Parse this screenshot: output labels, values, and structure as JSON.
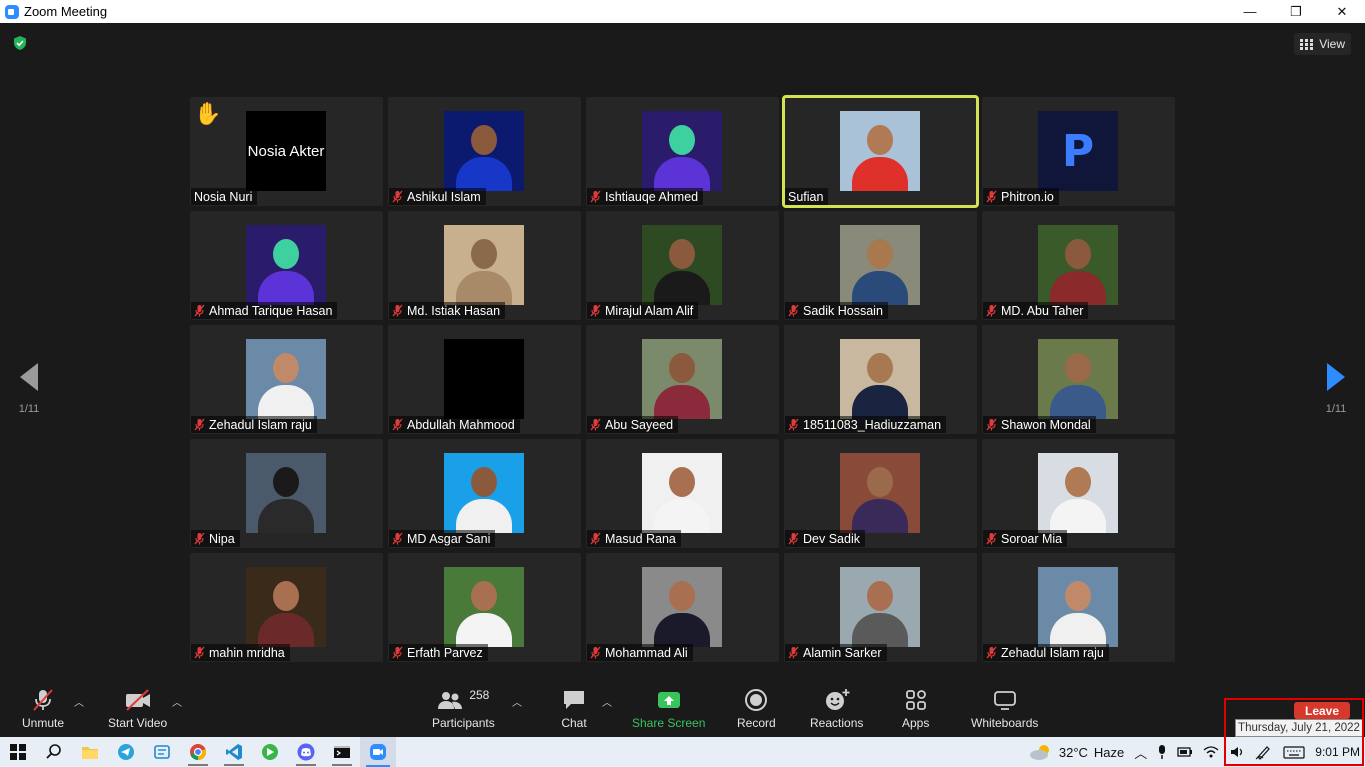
{
  "window": {
    "title": "Zoom Meeting",
    "minimize": "—",
    "maximize": "❐",
    "close": "✕"
  },
  "view_button": {
    "label": "View"
  },
  "pagination": {
    "left": "1/11",
    "right": "1/11"
  },
  "participants": [
    {
      "name": "Nosia Nuri",
      "avatar_text": "Nosia Akter",
      "avatar_bg": "#000000",
      "hand_raised": true,
      "muted": false
    },
    {
      "name": "Ashikul Islam",
      "avatar_bg": "#0b1a6e",
      "skin": "#8b5a3c",
      "shirt": "#1737c9",
      "muted": true
    },
    {
      "name": "Ishtiauqe Ahmed",
      "avatar_bg": "#2a1c6b",
      "skin": "#3fd0a0",
      "shirt": "#5b33d6",
      "muted": true
    },
    {
      "name": "Sufian",
      "avatar_bg": "#a9c2d8",
      "skin": "#b07a55",
      "shirt": "#e0302a",
      "muted": false,
      "active_speaker": true
    },
    {
      "name": "Phitron.io",
      "avatar_bg": "#10163a",
      "logo": "P",
      "muted": true
    },
    {
      "name": "Ahmad Tarique Hasan",
      "avatar_bg": "#2a1c6b",
      "skin": "#3fd0a0",
      "shirt": "#5b33d6",
      "muted": true
    },
    {
      "name": "Md. Istiak Hasan",
      "avatar_bg": "#c8b08e",
      "skin": "#8a6a4a",
      "shirt": "#a88a68",
      "muted": true
    },
    {
      "name": "Mirajul Alam Alif",
      "avatar_bg": "#2e4a22",
      "skin": "#8b5a3c",
      "shirt": "#1a1a1a",
      "muted": true
    },
    {
      "name": "Sadik Hossain",
      "avatar_bg": "#8a8a7a",
      "skin": "#a8784e",
      "shirt": "#2a4a7a",
      "muted": true
    },
    {
      "name": "MD. Abu Taher",
      "avatar_bg": "#3a5a2a",
      "skin": "#8b5a3c",
      "shirt": "#8a2a2a",
      "muted": true
    },
    {
      "name": "Zehadul Islam raju",
      "avatar_bg": "#6a8aa8",
      "skin": "#c08a6a",
      "shirt": "#f0f0f0",
      "muted": true
    },
    {
      "name": "Abdullah Mahmood",
      "avatar_bg": "#000000",
      "blank": true,
      "muted": true
    },
    {
      "name": "Abu Sayeed",
      "avatar_bg": "#7a8a6a",
      "skin": "#8b5a3c",
      "shirt": "#8a2a3a",
      "muted": true
    },
    {
      "name": "18511083_Hadiuzzaman",
      "avatar_bg": "#c8b8a0",
      "skin": "#a87850",
      "shirt": "#1a2440",
      "muted": true
    },
    {
      "name": "Shawon Mondal",
      "avatar_bg": "#6a7a4a",
      "skin": "#9a6a4a",
      "shirt": "#3a5a8a",
      "muted": true
    },
    {
      "name": "Nipa",
      "avatar_bg": "#4a5a6a",
      "skin": "#1a1a1a",
      "shirt": "#2a2a2a",
      "muted": true
    },
    {
      "name": "MD Asgar Sani",
      "avatar_bg": "#1aa0e8",
      "skin": "#8b5a3c",
      "shirt": "#f0f0f0",
      "muted": true
    },
    {
      "name": "Masud Rana",
      "avatar_bg": "#f0f0f0",
      "skin": "#a87050",
      "shirt": "#f4f4f4",
      "muted": true
    },
    {
      "name": "Dev Sadik",
      "avatar_bg": "#8a4a3a",
      "skin": "#9a6a4a",
      "shirt": "#3a2a5a",
      "muted": true
    },
    {
      "name": "Soroar Mia",
      "avatar_bg": "#d8dde4",
      "skin": "#b07a55",
      "shirt": "#f4f4f4",
      "muted": true
    },
    {
      "name": "mahin mridha",
      "avatar_bg": "#3a2a1a",
      "skin": "#a87050",
      "shirt": "#6a2a2a",
      "muted": true
    },
    {
      "name": "Erfath Parvez",
      "avatar_bg": "#4a7a3a",
      "skin": "#a87050",
      "shirt": "#f4f4f4",
      "muted": true
    },
    {
      "name": "Mohammad Ali",
      "avatar_bg": "#8a8a8a",
      "skin": "#a87050",
      "shirt": "#1a1a2a",
      "muted": true
    },
    {
      "name": "Alamin Sarker",
      "avatar_bg": "#9aa8b0",
      "skin": "#a87050",
      "shirt": "#5a5a5a",
      "muted": true
    },
    {
      "name": "Zehadul Islam raju",
      "avatar_bg": "#6a8aa8",
      "skin": "#c08a6a",
      "shirt": "#f0f0f0",
      "muted": true
    }
  ],
  "toolbar": {
    "unmute": "Unmute",
    "start_video": "Start Video",
    "participants": "Participants",
    "participant_count": "258",
    "chat": "Chat",
    "share_screen": "Share Screen",
    "record": "Record",
    "reactions": "Reactions",
    "apps": "Apps",
    "whiteboards": "Whiteboards",
    "leave": "Leave"
  },
  "tooltip": {
    "date": "Thursday, July 21, 2022"
  },
  "taskbar": {
    "apps": [
      "start-icon",
      "search-icon",
      "file-explorer-icon",
      "telegram-icon",
      "codeblocks-icon",
      "chrome-icon",
      "vscode-icon",
      "pushbullet-icon",
      "discord-icon",
      "terminal-icon",
      "zoom-icon"
    ],
    "weather": "32°C",
    "weather_text": "Haze",
    "time": "9:01 PM"
  },
  "colors": {
    "accent": "#2d8cff",
    "active_speaker": "#d4e353",
    "leave": "#d8382b",
    "share": "#39c35b",
    "muted": "#e03a3a"
  }
}
